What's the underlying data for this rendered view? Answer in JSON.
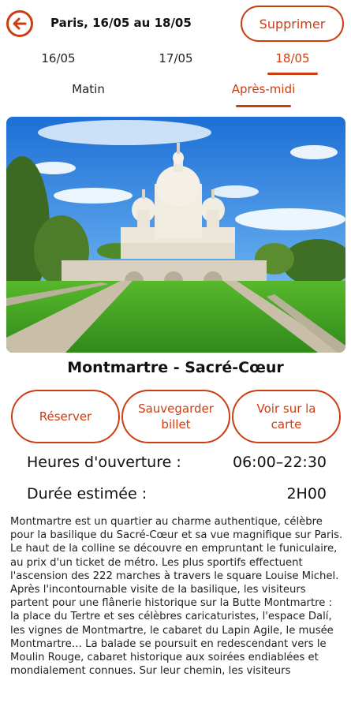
{
  "header": {
    "title": "Paris, 16/05 au 18/05",
    "delete_label": "Supprimer",
    "back_icon": "arrow-left-icon",
    "accent_color": "#cc3d12"
  },
  "day_tabs": [
    {
      "label": "16/05",
      "active": false
    },
    {
      "label": "17/05",
      "active": false
    },
    {
      "label": "18/05",
      "active": true
    }
  ],
  "period_tabs": [
    {
      "label": "Matin",
      "active": false
    },
    {
      "label": "Après-midi",
      "active": true
    }
  ],
  "place": {
    "title": "Montmartre - Sacré-Cœur",
    "actions": {
      "reserve": "Réserver",
      "save_ticket": "Sauvegarder billet",
      "map": "Voir sur la carte"
    },
    "opening_label": "Heures d'ouverture :",
    "opening_value": "06:00–22:30",
    "duration_label": "Durée estimée :",
    "duration_value": "2H00",
    "description": "Montmartre est un quartier au charme authentique, célèbre pour la basilique du Sacré-Cœur et sa vue magnifique sur Paris. Le haut de la colline se découvre en empruntant le funiculaire, au prix d'un ticket de métro. Les plus sportifs effectuent l'ascension des 222 marches à travers le square Louise Michel. Après l'incontournable visite de la basilique, les visiteurs partent pour une flânerie historique sur la Butte Montmartre : la place du Tertre et ses célèbres caricaturistes, l'espace Dalí, les vignes de Montmartre, le cabaret du Lapin Agile, le musée Montmartre… La balade se poursuit en redescendant vers le Moulin Rouge, cabaret historique aux soirées endiablées et mondialement connues. Sur leur chemin, les visiteurs"
  }
}
